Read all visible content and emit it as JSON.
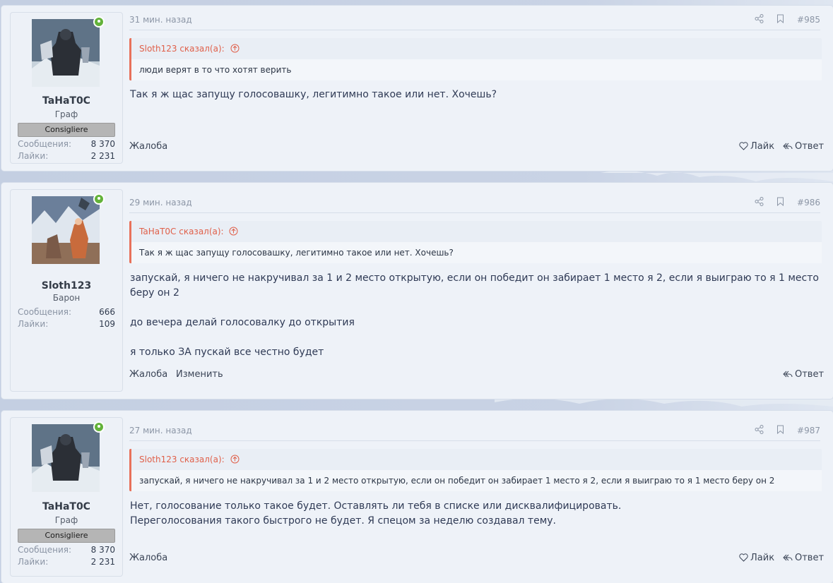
{
  "posts": [
    {
      "user": {
        "name": "TaHaT0C",
        "title": "Граф",
        "banner": "Consigliere",
        "messages_label": "Сообщения:",
        "messages": "8 370",
        "likes_label": "Лайки:",
        "likes": "2 231"
      },
      "time": "31 мин. назад",
      "number": "#985",
      "quote": {
        "author": "Sloth123 сказал(а):",
        "text": "люди верят в то что хотят верить"
      },
      "message": [
        "Так я ж щас запущу голосовашку, легитимно такое или нет. Хочешь?"
      ],
      "actions": {
        "report": "Жалоба",
        "like": "Лайк",
        "reply": "Ответ"
      }
    },
    {
      "user": {
        "name": "Sloth123",
        "title": "Барон",
        "messages_label": "Сообщения:",
        "messages": "666",
        "likes_label": "Лайки:",
        "likes": "109"
      },
      "time": "29 мин. назад",
      "number": "#986",
      "quote": {
        "author": "TaHaT0C сказал(а):",
        "text": "Так я ж щас запущу голосовашку, легитимно такое или нет. Хочешь?"
      },
      "message": [
        "запускай, я ничего не накручивал за 1 и 2 место открытую, если он победит он забирает 1 место я 2, если я выиграю то я 1 место беру он 2",
        "до вечера делай голосовалку до открытия",
        "я только ЗА пускай все честно будет"
      ],
      "actions": {
        "report": "Жалоба",
        "edit": "Изменить",
        "reply": "Ответ"
      }
    },
    {
      "user": {
        "name": "TaHaT0C",
        "title": "Граф",
        "banner": "Consigliere",
        "messages_label": "Сообщения:",
        "messages": "8 370",
        "likes_label": "Лайки:",
        "likes": "2 231"
      },
      "time": "27 мин. назад",
      "number": "#987",
      "quote": {
        "author": "Sloth123 сказал(а):",
        "text": "запускай, я ничего не накручивал за 1 и 2 место открытую, если он победит он забирает 1 место я 2, если я выиграю то я 1 место беру он 2"
      },
      "message": [
        "Нет, голосование только такое будет. Оставлять ли тебя в списке или дисквалифицировать.",
        "Переголосования такого быстрого не будет. Я спецом за неделю создавал тему."
      ],
      "actions": {
        "report": "Жалоба",
        "like": "Лайк",
        "reply": "Ответ"
      }
    }
  ],
  "icons": [
    "share-icon",
    "bookmark-icon",
    "quote-arrow-up-icon",
    "heart-icon",
    "reply-icon",
    "online-status-icon"
  ],
  "colors": {
    "accent": "#e0604a",
    "online": "#63b23a",
    "page_bg": "#c3cfe2",
    "post_bg": "#eef2f8"
  }
}
